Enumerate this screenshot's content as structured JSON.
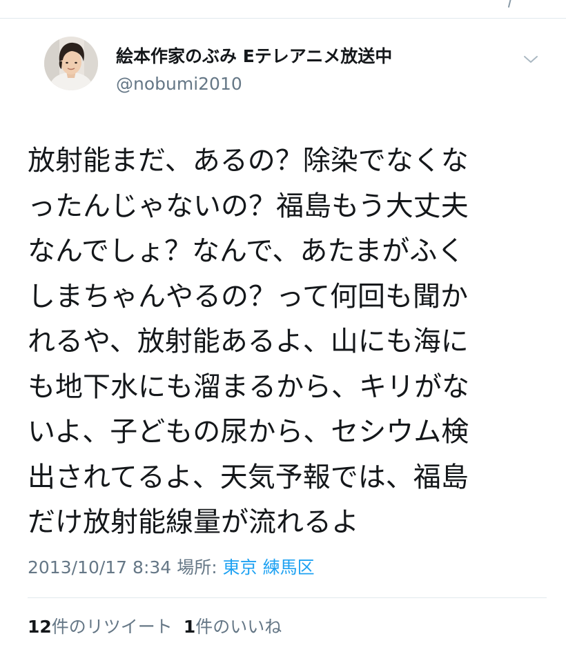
{
  "tweet": {
    "author": {
      "display_name": "絵本作家のぶみ Eテレアニメ放送中",
      "handle": "@nobumi2010"
    },
    "text_lines": [
      "放射能まだ、あるの？除染でなくな",
      "ったんじゃないの？福島もう大丈夫",
      "なんでしょ？なんで、あたまがふく",
      "しまちゃんやるの？って何回も聞か",
      "れるや、放射能あるよ、山にも海に",
      "も地下水にも溜まるから、キリがな",
      "いよ、子どもの尿から、セシウム検",
      "出されてるよ、天気予報では、福島",
      "だけ放射能線量が流れるよ"
    ],
    "timestamp": "2013/10/17 8:34",
    "location_label": "場所:",
    "location": "東京 練馬区",
    "stats": {
      "retweet_count": "12",
      "retweet_label": "件のリツイート",
      "like_count": "1",
      "like_label": "件のいいね"
    }
  },
  "colors": {
    "text_primary": "#14171a",
    "text_secondary": "#657786",
    "link": "#1da1f2",
    "divider": "#e1e8ed"
  },
  "icons": [
    "share-icon",
    "chevron-down-icon"
  ]
}
